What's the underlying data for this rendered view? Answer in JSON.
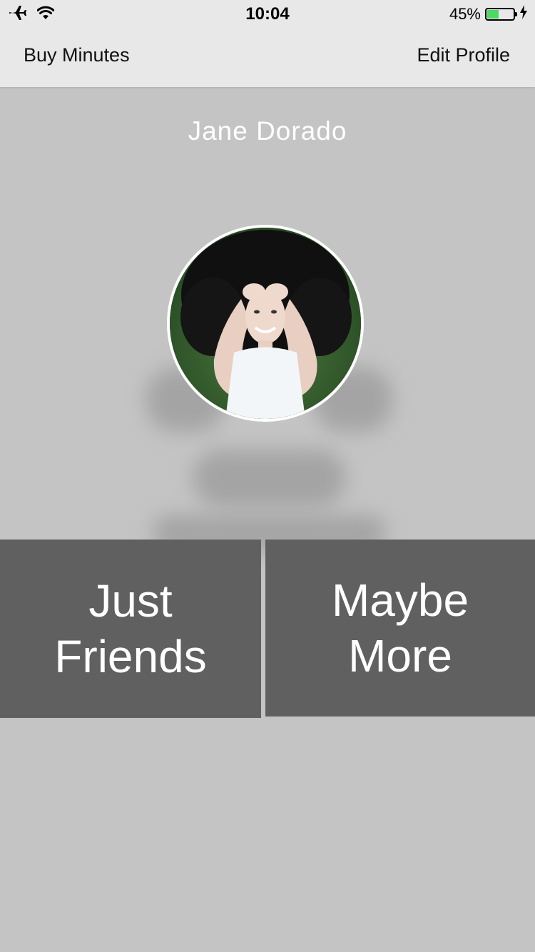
{
  "status_bar": {
    "time": "10:04",
    "battery_percent_label": "45%",
    "battery_level": 0.45,
    "battery_color": "#4cd964",
    "left_icons": [
      "airplane-icon",
      "wifi-icon"
    ],
    "right_icons": [
      "battery-icon",
      "charging-bolt-icon"
    ]
  },
  "nav": {
    "left_label": "Buy Minutes",
    "right_label": "Edit Profile"
  },
  "profile": {
    "name": "Jane Dorado",
    "avatar": "profile-photo"
  },
  "choices": {
    "left": {
      "line1": "Just",
      "line2": "Friends"
    },
    "right": {
      "line1": "Maybe",
      "line2": "More"
    }
  },
  "colors": {
    "background": "#c4c4c4",
    "header": "#e8e8e8",
    "button": "#606060",
    "text_light": "#ffffff"
  }
}
